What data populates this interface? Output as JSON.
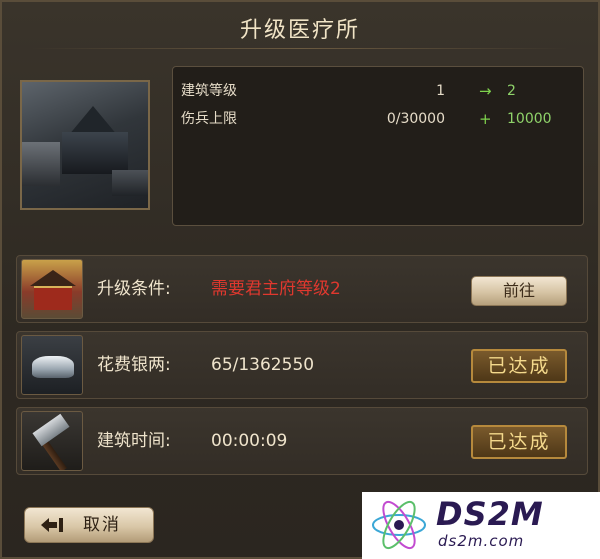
{
  "dialog": {
    "title": "升级医疗所"
  },
  "stats": [
    {
      "label": "建筑等级",
      "from": "1",
      "symbol": "→",
      "to": "2"
    },
    {
      "label": "伤兵上限",
      "from": "0/30000",
      "symbol": "+",
      "to": "10000"
    }
  ],
  "requirements": [
    {
      "icon": "palace-icon",
      "label": "升级条件:",
      "value": "需要君主府等级2",
      "value_color": "#e0382e",
      "action": "前往"
    },
    {
      "icon": "silver-ingot-icon",
      "label": "花费银两:",
      "value": "65/1362550",
      "status": "已达成"
    },
    {
      "icon": "hammer-icon",
      "label": "建筑时间:",
      "value": "00:00:09",
      "status": "已达成"
    }
  ],
  "footer": {
    "cancel_label": "取消"
  },
  "watermark": {
    "brand": "DS2M",
    "domain": "ds2m.com"
  },
  "colors": {
    "accent_green": "#7fd34d",
    "warning_red": "#e0382e",
    "gold": "#f4d98c"
  }
}
